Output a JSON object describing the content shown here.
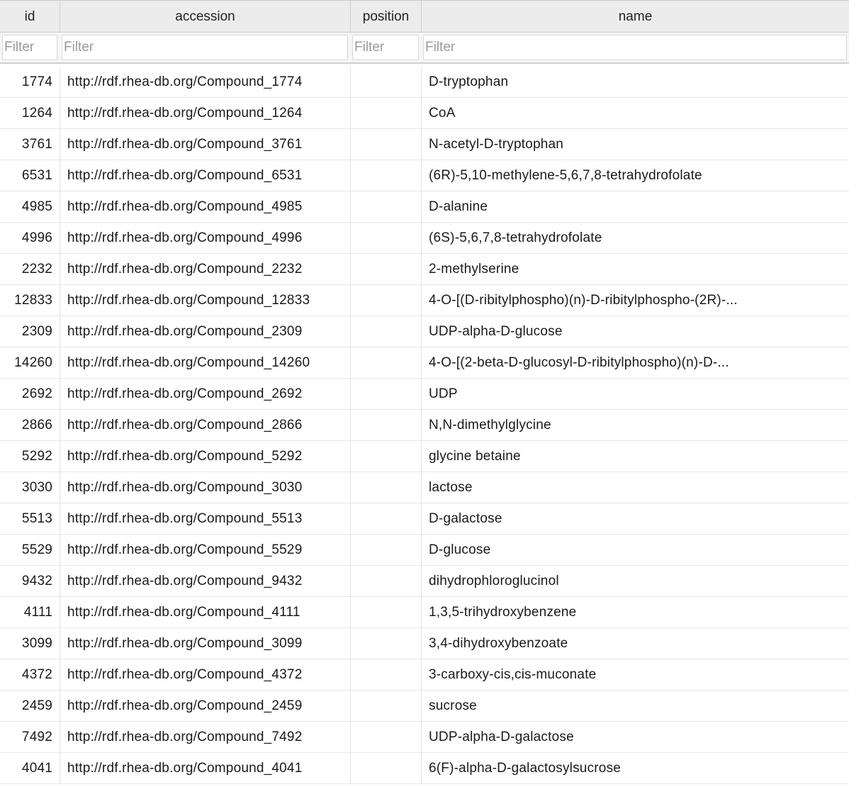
{
  "columns": {
    "id": "id",
    "accession": "accession",
    "position": "position",
    "name": "name"
  },
  "filter_placeholder": "Filter",
  "rows": [
    {
      "id": "1774",
      "accession": "http://rdf.rhea-db.org/Compound_1774",
      "position": "",
      "name": "D-tryptophan"
    },
    {
      "id": "1264",
      "accession": "http://rdf.rhea-db.org/Compound_1264",
      "position": "",
      "name": "CoA"
    },
    {
      "id": "3761",
      "accession": "http://rdf.rhea-db.org/Compound_3761",
      "position": "",
      "name": "N-acetyl-D-tryptophan"
    },
    {
      "id": "6531",
      "accession": "http://rdf.rhea-db.org/Compound_6531",
      "position": "",
      "name": "(6R)-5,10-methylene-5,6,7,8-tetrahydrofolate"
    },
    {
      "id": "4985",
      "accession": "http://rdf.rhea-db.org/Compound_4985",
      "position": "",
      "name": "D-alanine"
    },
    {
      "id": "4996",
      "accession": "http://rdf.rhea-db.org/Compound_4996",
      "position": "",
      "name": "(6S)-5,6,7,8-tetrahydrofolate"
    },
    {
      "id": "2232",
      "accession": "http://rdf.rhea-db.org/Compound_2232",
      "position": "",
      "name": "2-methylserine"
    },
    {
      "id": "12833",
      "accession": "http://rdf.rhea-db.org/Compound_12833",
      "position": "",
      "name": "4-O-[(D-ribitylphospho)(n)-D-ribitylphospho-(2R)-..."
    },
    {
      "id": "2309",
      "accession": "http://rdf.rhea-db.org/Compound_2309",
      "position": "",
      "name": "UDP-alpha-D-glucose"
    },
    {
      "id": "14260",
      "accession": "http://rdf.rhea-db.org/Compound_14260",
      "position": "",
      "name": "4-O-[(2-beta-D-glucosyl-D-ribitylphospho)(n)-D-..."
    },
    {
      "id": "2692",
      "accession": "http://rdf.rhea-db.org/Compound_2692",
      "position": "",
      "name": "UDP"
    },
    {
      "id": "2866",
      "accession": "http://rdf.rhea-db.org/Compound_2866",
      "position": "",
      "name": "N,N-dimethylglycine"
    },
    {
      "id": "5292",
      "accession": "http://rdf.rhea-db.org/Compound_5292",
      "position": "",
      "name": "glycine betaine"
    },
    {
      "id": "3030",
      "accession": "http://rdf.rhea-db.org/Compound_3030",
      "position": "",
      "name": "lactose"
    },
    {
      "id": "5513",
      "accession": "http://rdf.rhea-db.org/Compound_5513",
      "position": "",
      "name": "D-galactose"
    },
    {
      "id": "5529",
      "accession": "http://rdf.rhea-db.org/Compound_5529",
      "position": "",
      "name": "D-glucose"
    },
    {
      "id": "9432",
      "accession": "http://rdf.rhea-db.org/Compound_9432",
      "position": "",
      "name": "dihydrophloroglucinol"
    },
    {
      "id": "4111",
      "accession": "http://rdf.rhea-db.org/Compound_4111",
      "position": "",
      "name": "1,3,5-trihydroxybenzene"
    },
    {
      "id": "3099",
      "accession": "http://rdf.rhea-db.org/Compound_3099",
      "position": "",
      "name": "3,4-dihydroxybenzoate"
    },
    {
      "id": "4372",
      "accession": "http://rdf.rhea-db.org/Compound_4372",
      "position": "",
      "name": "3-carboxy-cis,cis-muconate"
    },
    {
      "id": "2459",
      "accession": "http://rdf.rhea-db.org/Compound_2459",
      "position": "",
      "name": "sucrose"
    },
    {
      "id": "7492",
      "accession": "http://rdf.rhea-db.org/Compound_7492",
      "position": "",
      "name": "UDP-alpha-D-galactose"
    },
    {
      "id": "4041",
      "accession": "http://rdf.rhea-db.org/Compound_4041",
      "position": "",
      "name": "6(F)-alpha-D-galactosylsucrose"
    }
  ]
}
